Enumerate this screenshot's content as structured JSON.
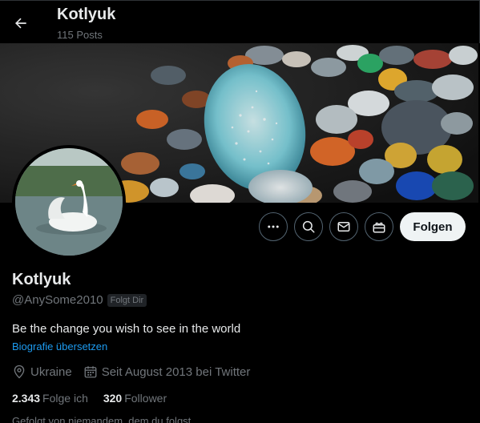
{
  "header": {
    "name": "Kotlyuk",
    "posts": "115 Posts"
  },
  "profile": {
    "name": "Kotlyuk",
    "handle": "@AnySome2010",
    "follows_you": "Folgt Dir",
    "bio": "Be the change you wish to see in the world",
    "translate_bio": "Biografie übersetzen",
    "location": "Ukraine",
    "joined": "Seit August 2013 bei Twitter",
    "following_count": "2.343",
    "following_label": "Folge ich",
    "followers_count": "320",
    "followers_label": "Follower",
    "followed_by": "Gefolgt von niemandem, dem du folgst"
  },
  "actions": {
    "follow_label": "Folgen",
    "icons": [
      "more-icon",
      "search-icon",
      "message-icon",
      "subscribe-icon"
    ]
  },
  "colors": {
    "background": "#000000",
    "link": "#1d9bf0",
    "muted": "#71767b",
    "button_bg": "#eff3f4"
  }
}
